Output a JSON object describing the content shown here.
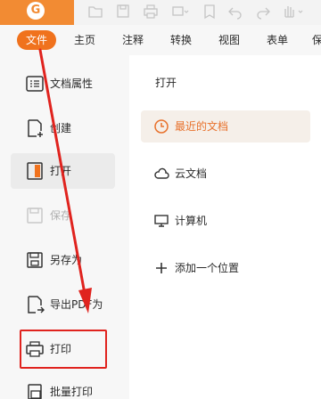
{
  "app": {
    "logo_letter": "G",
    "accent_color": "#f0721d",
    "logo_bg_color": "#f28b33"
  },
  "toolbar": {
    "icons": [
      "open-folder-icon",
      "save-icon",
      "print-icon",
      "image-dropdown-icon",
      "bookmark-icon",
      "undo-icon",
      "redo-icon",
      "hand-tool-icon"
    ]
  },
  "menubar": {
    "items": [
      {
        "label": "文件",
        "active": true
      },
      {
        "label": "主页",
        "active": false
      },
      {
        "label": "注释",
        "active": false
      },
      {
        "label": "转换",
        "active": false
      },
      {
        "label": "视图",
        "active": false
      },
      {
        "label": "表单",
        "active": false
      },
      {
        "label": "保",
        "active": false
      }
    ]
  },
  "sidebar": {
    "items": [
      {
        "label": "文档属性",
        "icon": "document-properties-icon",
        "state": "normal"
      },
      {
        "label": "创建",
        "icon": "create-document-icon",
        "state": "normal"
      },
      {
        "label": "打开",
        "icon": "open-icon",
        "state": "active"
      },
      {
        "label": "保存",
        "icon": "save-icon",
        "state": "disabled"
      },
      {
        "label": "另存为",
        "icon": "save-as-icon",
        "state": "normal"
      },
      {
        "label": "导出PDF为",
        "icon": "export-pdf-icon",
        "state": "normal"
      },
      {
        "label": "打印",
        "icon": "print-icon",
        "state": "normal"
      },
      {
        "label": "批量打印",
        "icon": "batch-print-icon",
        "state": "normal"
      }
    ]
  },
  "open_panel": {
    "title": "打开",
    "locations": [
      {
        "label": "最近的文档",
        "icon": "clock-icon",
        "active": true
      },
      {
        "label": "云文档",
        "icon": "cloud-icon",
        "active": false
      },
      {
        "label": "计算机",
        "icon": "computer-icon",
        "active": false
      },
      {
        "label": "添加一个位置",
        "icon": "plus-icon",
        "active": false
      }
    ]
  },
  "annotation": {
    "highlight_color": "#e0231e",
    "arrow_color": "#e0231e"
  }
}
